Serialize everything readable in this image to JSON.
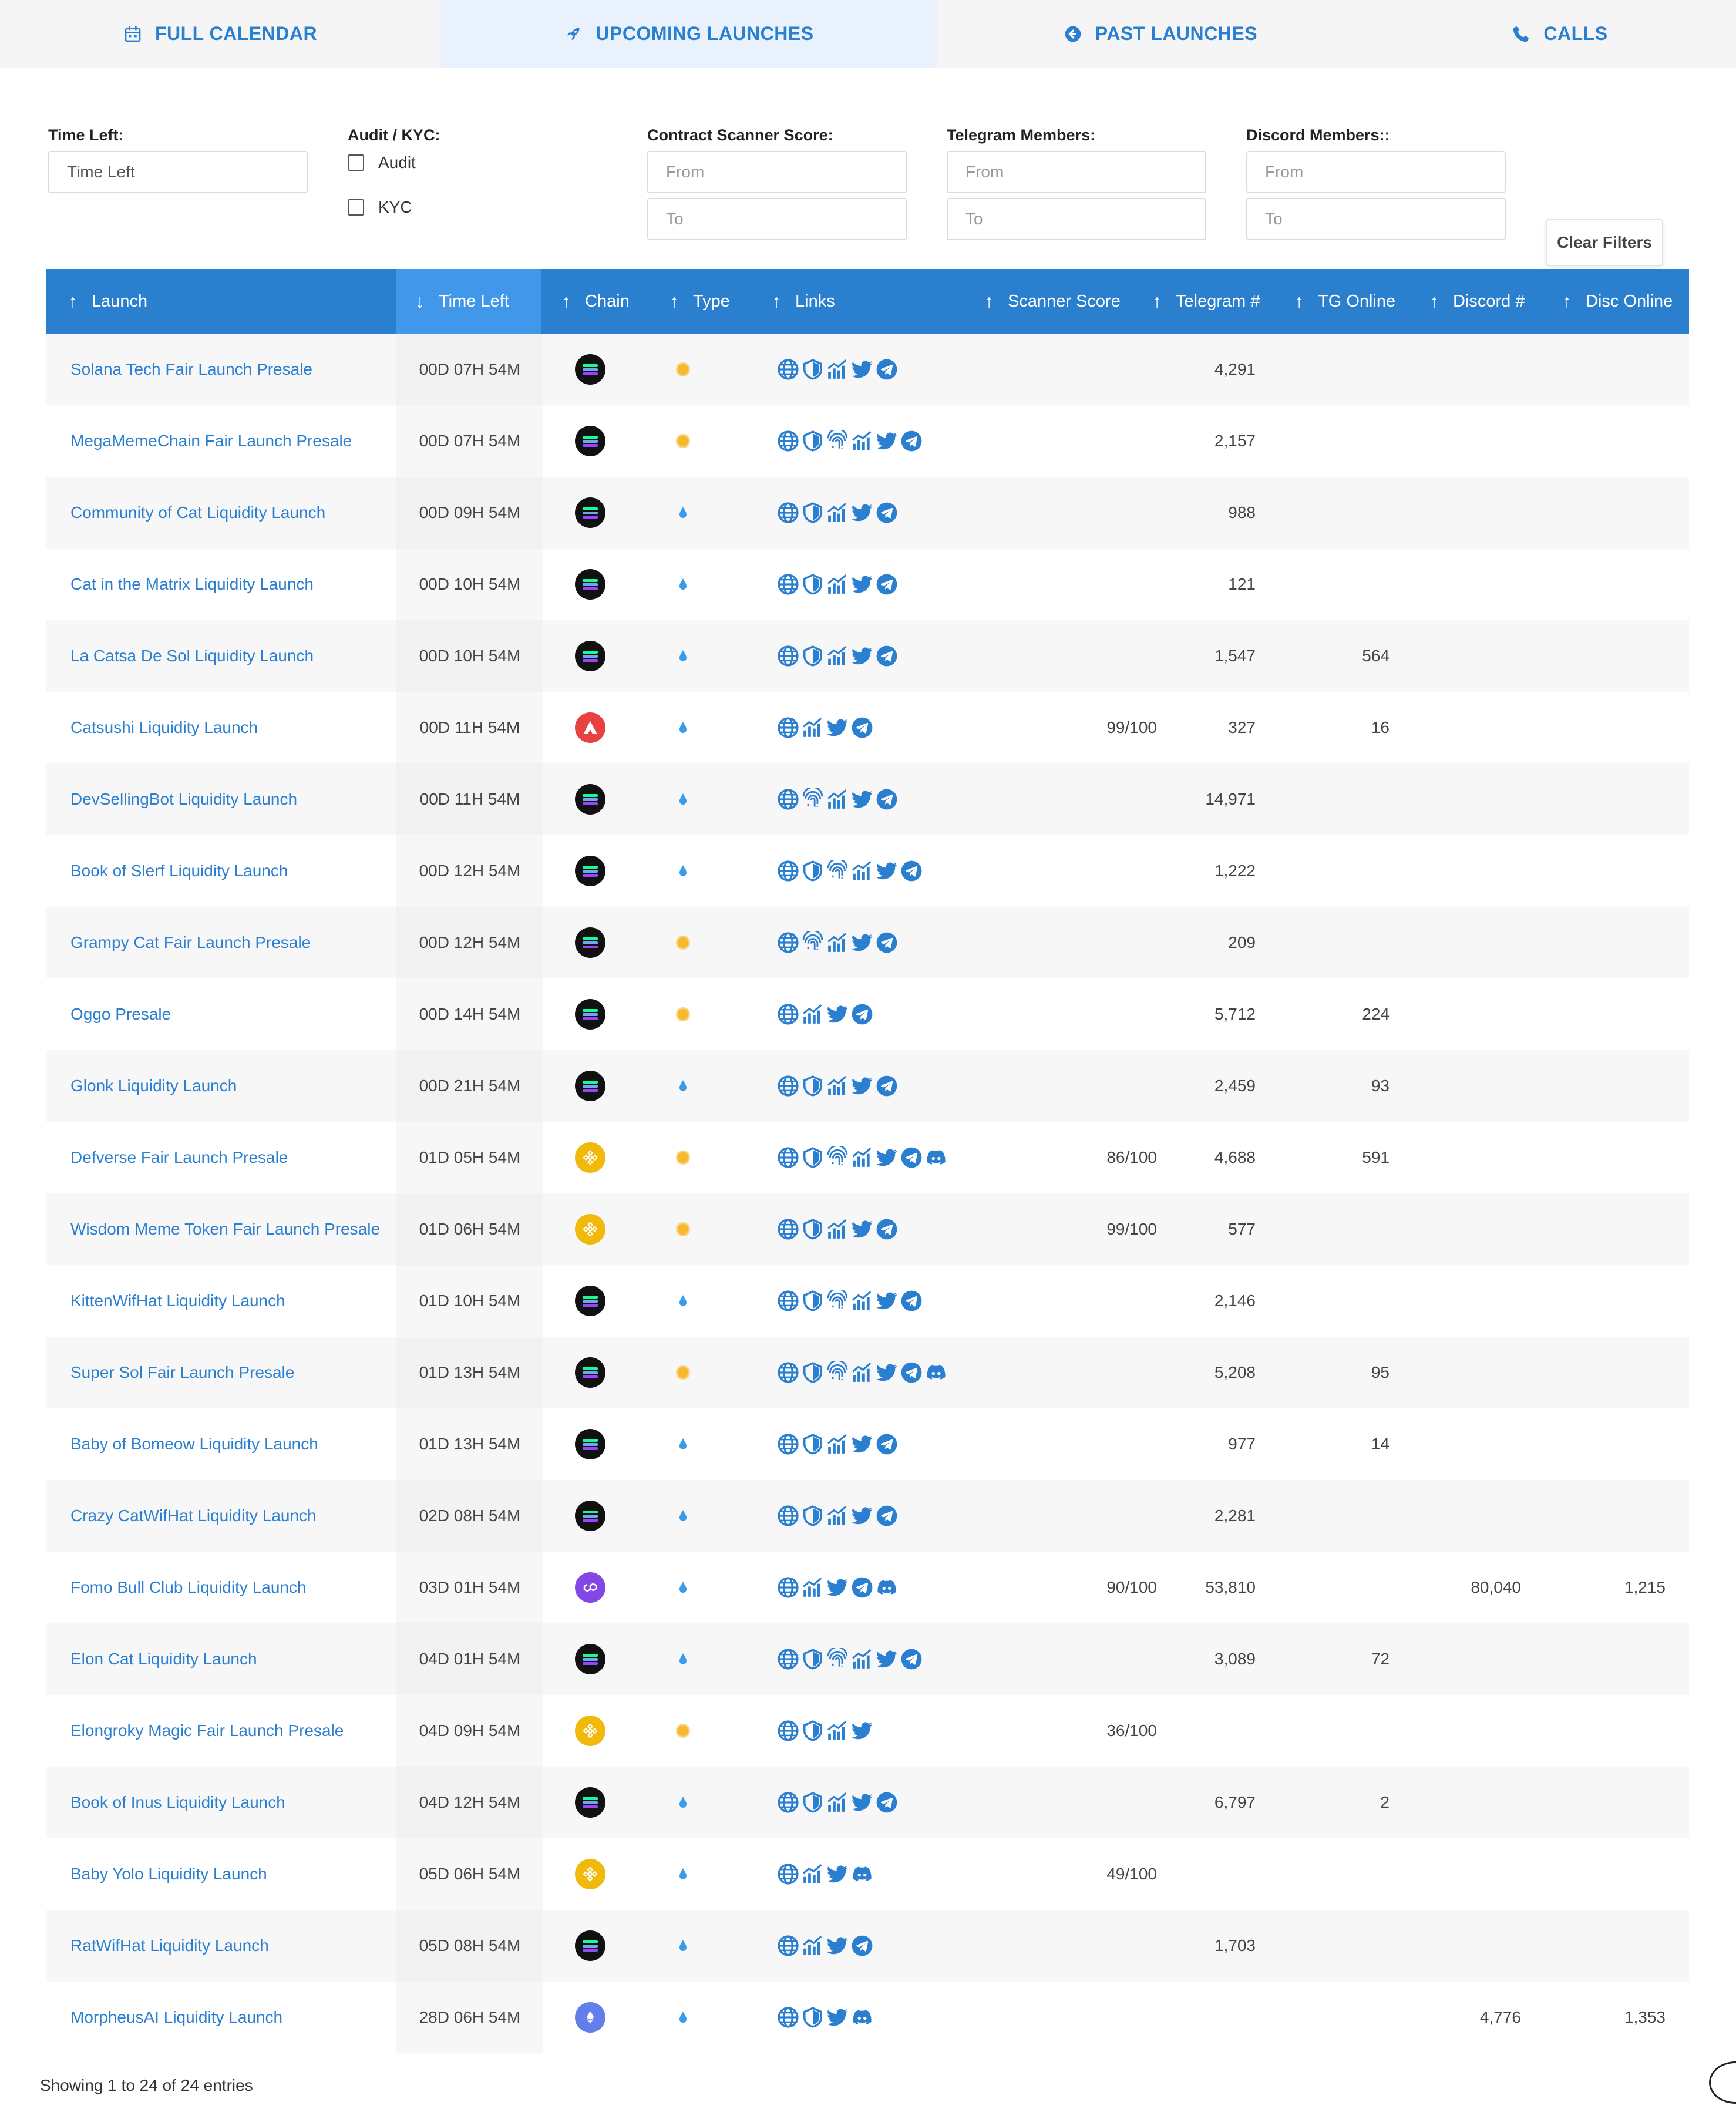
{
  "tabs": [
    {
      "label": "FULL CALENDAR",
      "icon": "calendar-icon",
      "active": false
    },
    {
      "label": "UPCOMING LAUNCHES",
      "icon": "rocket-icon",
      "active": true
    },
    {
      "label": "PAST LAUNCHES",
      "icon": "back-arrow-icon",
      "active": false
    },
    {
      "label": "CALLS",
      "icon": "phone-icon",
      "active": false
    }
  ],
  "filters": {
    "time_left": {
      "label": "Time Left:",
      "value": "Time Left"
    },
    "audit_kyc": {
      "label": "Audit / KYC:",
      "audit": "Audit",
      "kyc": "KYC"
    },
    "scanner": {
      "label": "Contract Scanner Score:",
      "from": "From",
      "to": "To"
    },
    "telegram": {
      "label": "Telegram Members:",
      "from": "From",
      "to": "To"
    },
    "discord": {
      "label": "Discord Members::",
      "from": "From",
      "to": "To"
    },
    "clear": "Clear Filters"
  },
  "columns": {
    "launch": "Launch",
    "time_left": "Time Left",
    "chain": "Chain",
    "type": "Type",
    "links": "Links",
    "scanner": "Scanner Score",
    "telegram": "Telegram #",
    "tg_online": "TG Online",
    "discord": "Discord #",
    "disc_online": "Disc Online"
  },
  "colors": {
    "header": "#2a7fcf",
    "sorted": "#4197ea",
    "link": "#2b7fd0"
  },
  "rows": [
    {
      "name": "Solana Tech Fair Launch Presale",
      "time": "00D 07H 54M",
      "chain": "sol",
      "type": "presale",
      "links": [
        "web",
        "shield",
        "chart",
        "twitter",
        "telegram"
      ],
      "score": "",
      "tg": "4,291",
      "tgo": "",
      "dc": "",
      "dco": ""
    },
    {
      "name": "MegaMemeChain Fair Launch Presale",
      "time": "00D 07H 54M",
      "chain": "sol",
      "type": "presale",
      "links": [
        "web",
        "shield",
        "finger",
        "chart",
        "twitter",
        "telegram"
      ],
      "score": "",
      "tg": "2,157",
      "tgo": "",
      "dc": "",
      "dco": ""
    },
    {
      "name": "Community of Cat Liquidity Launch",
      "time": "00D 09H 54M",
      "chain": "sol",
      "type": "liquidity",
      "links": [
        "web",
        "shield",
        "chart",
        "twitter",
        "telegram"
      ],
      "score": "",
      "tg": "988",
      "tgo": "",
      "dc": "",
      "dco": ""
    },
    {
      "name": "Cat in the Matrix Liquidity Launch",
      "time": "00D 10H 54M",
      "chain": "sol",
      "type": "liquidity",
      "links": [
        "web",
        "shield",
        "chart",
        "twitter",
        "telegram"
      ],
      "score": "",
      "tg": "121",
      "tgo": "",
      "dc": "",
      "dco": ""
    },
    {
      "name": "La Catsa De Sol Liquidity Launch",
      "time": "00D 10H 54M",
      "chain": "sol",
      "type": "liquidity",
      "links": [
        "web",
        "shield",
        "chart",
        "twitter",
        "telegram"
      ],
      "score": "",
      "tg": "1,547",
      "tgo": "564",
      "dc": "",
      "dco": ""
    },
    {
      "name": "Catsushi Liquidity Launch",
      "time": "00D 11H 54M",
      "chain": "avax",
      "type": "liquidity",
      "links": [
        "web",
        "chart",
        "twitter",
        "telegram"
      ],
      "score": "99/100",
      "tg": "327",
      "tgo": "16",
      "dc": "",
      "dco": ""
    },
    {
      "name": "DevSellingBot Liquidity Launch",
      "time": "00D 11H 54M",
      "chain": "sol",
      "type": "liquidity",
      "links": [
        "web",
        "finger",
        "chart",
        "twitter",
        "telegram"
      ],
      "score": "",
      "tg": "14,971",
      "tgo": "",
      "dc": "",
      "dco": ""
    },
    {
      "name": "Book of Slerf Liquidity Launch",
      "time": "00D 12H 54M",
      "chain": "sol",
      "type": "liquidity",
      "links": [
        "web",
        "shield",
        "finger",
        "chart",
        "twitter",
        "telegram"
      ],
      "score": "",
      "tg": "1,222",
      "tgo": "",
      "dc": "",
      "dco": ""
    },
    {
      "name": "Grampy Cat Fair Launch Presale",
      "time": "00D 12H 54M",
      "chain": "sol",
      "type": "presale",
      "links": [
        "web",
        "finger",
        "chart",
        "twitter",
        "telegram"
      ],
      "score": "",
      "tg": "209",
      "tgo": "",
      "dc": "",
      "dco": ""
    },
    {
      "name": "Oggo Presale",
      "time": "00D 14H 54M",
      "chain": "sol",
      "type": "presale",
      "links": [
        "web",
        "chart",
        "twitter",
        "telegram"
      ],
      "score": "",
      "tg": "5,712",
      "tgo": "224",
      "dc": "",
      "dco": ""
    },
    {
      "name": "Glonk Liquidity Launch",
      "time": "00D 21H 54M",
      "chain": "sol",
      "type": "liquidity",
      "links": [
        "web",
        "shield",
        "chart",
        "twitter",
        "telegram"
      ],
      "score": "",
      "tg": "2,459",
      "tgo": "93",
      "dc": "",
      "dco": ""
    },
    {
      "name": "Defverse Fair Launch Presale",
      "time": "01D 05H 54M",
      "chain": "bnb",
      "type": "presale",
      "links": [
        "web",
        "shield",
        "finger",
        "chart",
        "twitter",
        "telegram",
        "discord"
      ],
      "score": "86/100",
      "tg": "4,688",
      "tgo": "591",
      "dc": "",
      "dco": ""
    },
    {
      "name": "Wisdom Meme Token Fair Launch Presale",
      "time": "01D 06H 54M",
      "chain": "bnb",
      "type": "presale",
      "links": [
        "web",
        "shield",
        "chart",
        "twitter",
        "telegram"
      ],
      "score": "99/100",
      "tg": "577",
      "tgo": "",
      "dc": "",
      "dco": ""
    },
    {
      "name": "KittenWifHat Liquidity Launch",
      "time": "01D 10H 54M",
      "chain": "sol",
      "type": "liquidity",
      "links": [
        "web",
        "shield",
        "finger",
        "chart",
        "twitter",
        "telegram"
      ],
      "score": "",
      "tg": "2,146",
      "tgo": "",
      "dc": "",
      "dco": ""
    },
    {
      "name": "Super Sol Fair Launch Presale",
      "time": "01D 13H 54M",
      "chain": "sol",
      "type": "presale",
      "links": [
        "web",
        "shield",
        "finger",
        "chart",
        "twitter",
        "telegram",
        "discord"
      ],
      "score": "",
      "tg": "5,208",
      "tgo": "95",
      "dc": "",
      "dco": ""
    },
    {
      "name": "Baby of Bomeow Liquidity Launch",
      "time": "01D 13H 54M",
      "chain": "sol",
      "type": "liquidity",
      "links": [
        "web",
        "shield",
        "chart",
        "twitter",
        "telegram"
      ],
      "score": "",
      "tg": "977",
      "tgo": "14",
      "dc": "",
      "dco": ""
    },
    {
      "name": "Crazy CatWifHat Liquidity Launch",
      "time": "02D 08H 54M",
      "chain": "sol",
      "type": "liquidity",
      "links": [
        "web",
        "shield",
        "chart",
        "twitter",
        "telegram"
      ],
      "score": "",
      "tg": "2,281",
      "tgo": "",
      "dc": "",
      "dco": ""
    },
    {
      "name": "Fomo Bull Club Liquidity Launch",
      "time": "03D 01H 54M",
      "chain": "poly",
      "type": "liquidity",
      "links": [
        "web",
        "chart",
        "twitter",
        "telegram",
        "discord"
      ],
      "score": "90/100",
      "tg": "53,810",
      "tgo": "",
      "dc": "80,040",
      "dco": "1,215"
    },
    {
      "name": "Elon Cat Liquidity Launch",
      "time": "04D 01H 54M",
      "chain": "sol",
      "type": "liquidity",
      "links": [
        "web",
        "shield",
        "finger",
        "chart",
        "twitter",
        "telegram"
      ],
      "score": "",
      "tg": "3,089",
      "tgo": "72",
      "dc": "",
      "dco": ""
    },
    {
      "name": "Elongroky Magic Fair Launch Presale",
      "time": "04D 09H 54M",
      "chain": "bnb",
      "type": "presale",
      "links": [
        "web",
        "shield",
        "chart",
        "twitter"
      ],
      "score": "36/100",
      "tg": "",
      "tgo": "",
      "dc": "",
      "dco": ""
    },
    {
      "name": "Book of Inus Liquidity Launch",
      "time": "04D 12H 54M",
      "chain": "sol",
      "type": "liquidity",
      "links": [
        "web",
        "shield",
        "chart",
        "twitter",
        "telegram"
      ],
      "score": "",
      "tg": "6,797",
      "tgo": "2",
      "dc": "",
      "dco": ""
    },
    {
      "name": "Baby Yolo Liquidity Launch",
      "time": "05D 06H 54M",
      "chain": "bnb",
      "type": "liquidity",
      "links": [
        "web",
        "chart",
        "twitter",
        "discord"
      ],
      "score": "49/100",
      "tg": "",
      "tgo": "",
      "dc": "",
      "dco": ""
    },
    {
      "name": "RatWifHat Liquidity Launch",
      "time": "05D 08H 54M",
      "chain": "sol",
      "type": "liquidity",
      "links": [
        "web",
        "chart",
        "twitter",
        "telegram"
      ],
      "score": "",
      "tg": "1,703",
      "tgo": "",
      "dc": "",
      "dco": ""
    },
    {
      "name": "MorpheusAI Liquidity Launch",
      "time": "28D 06H 54M",
      "chain": "eth",
      "type": "liquidity",
      "links": [
        "web",
        "shield",
        "twitter",
        "discord"
      ],
      "score": "",
      "tg": "",
      "tgo": "",
      "dc": "4,776",
      "dco": "1,353"
    }
  ],
  "footer": {
    "showing": "Showing 1 to 24 of 24 entries"
  }
}
